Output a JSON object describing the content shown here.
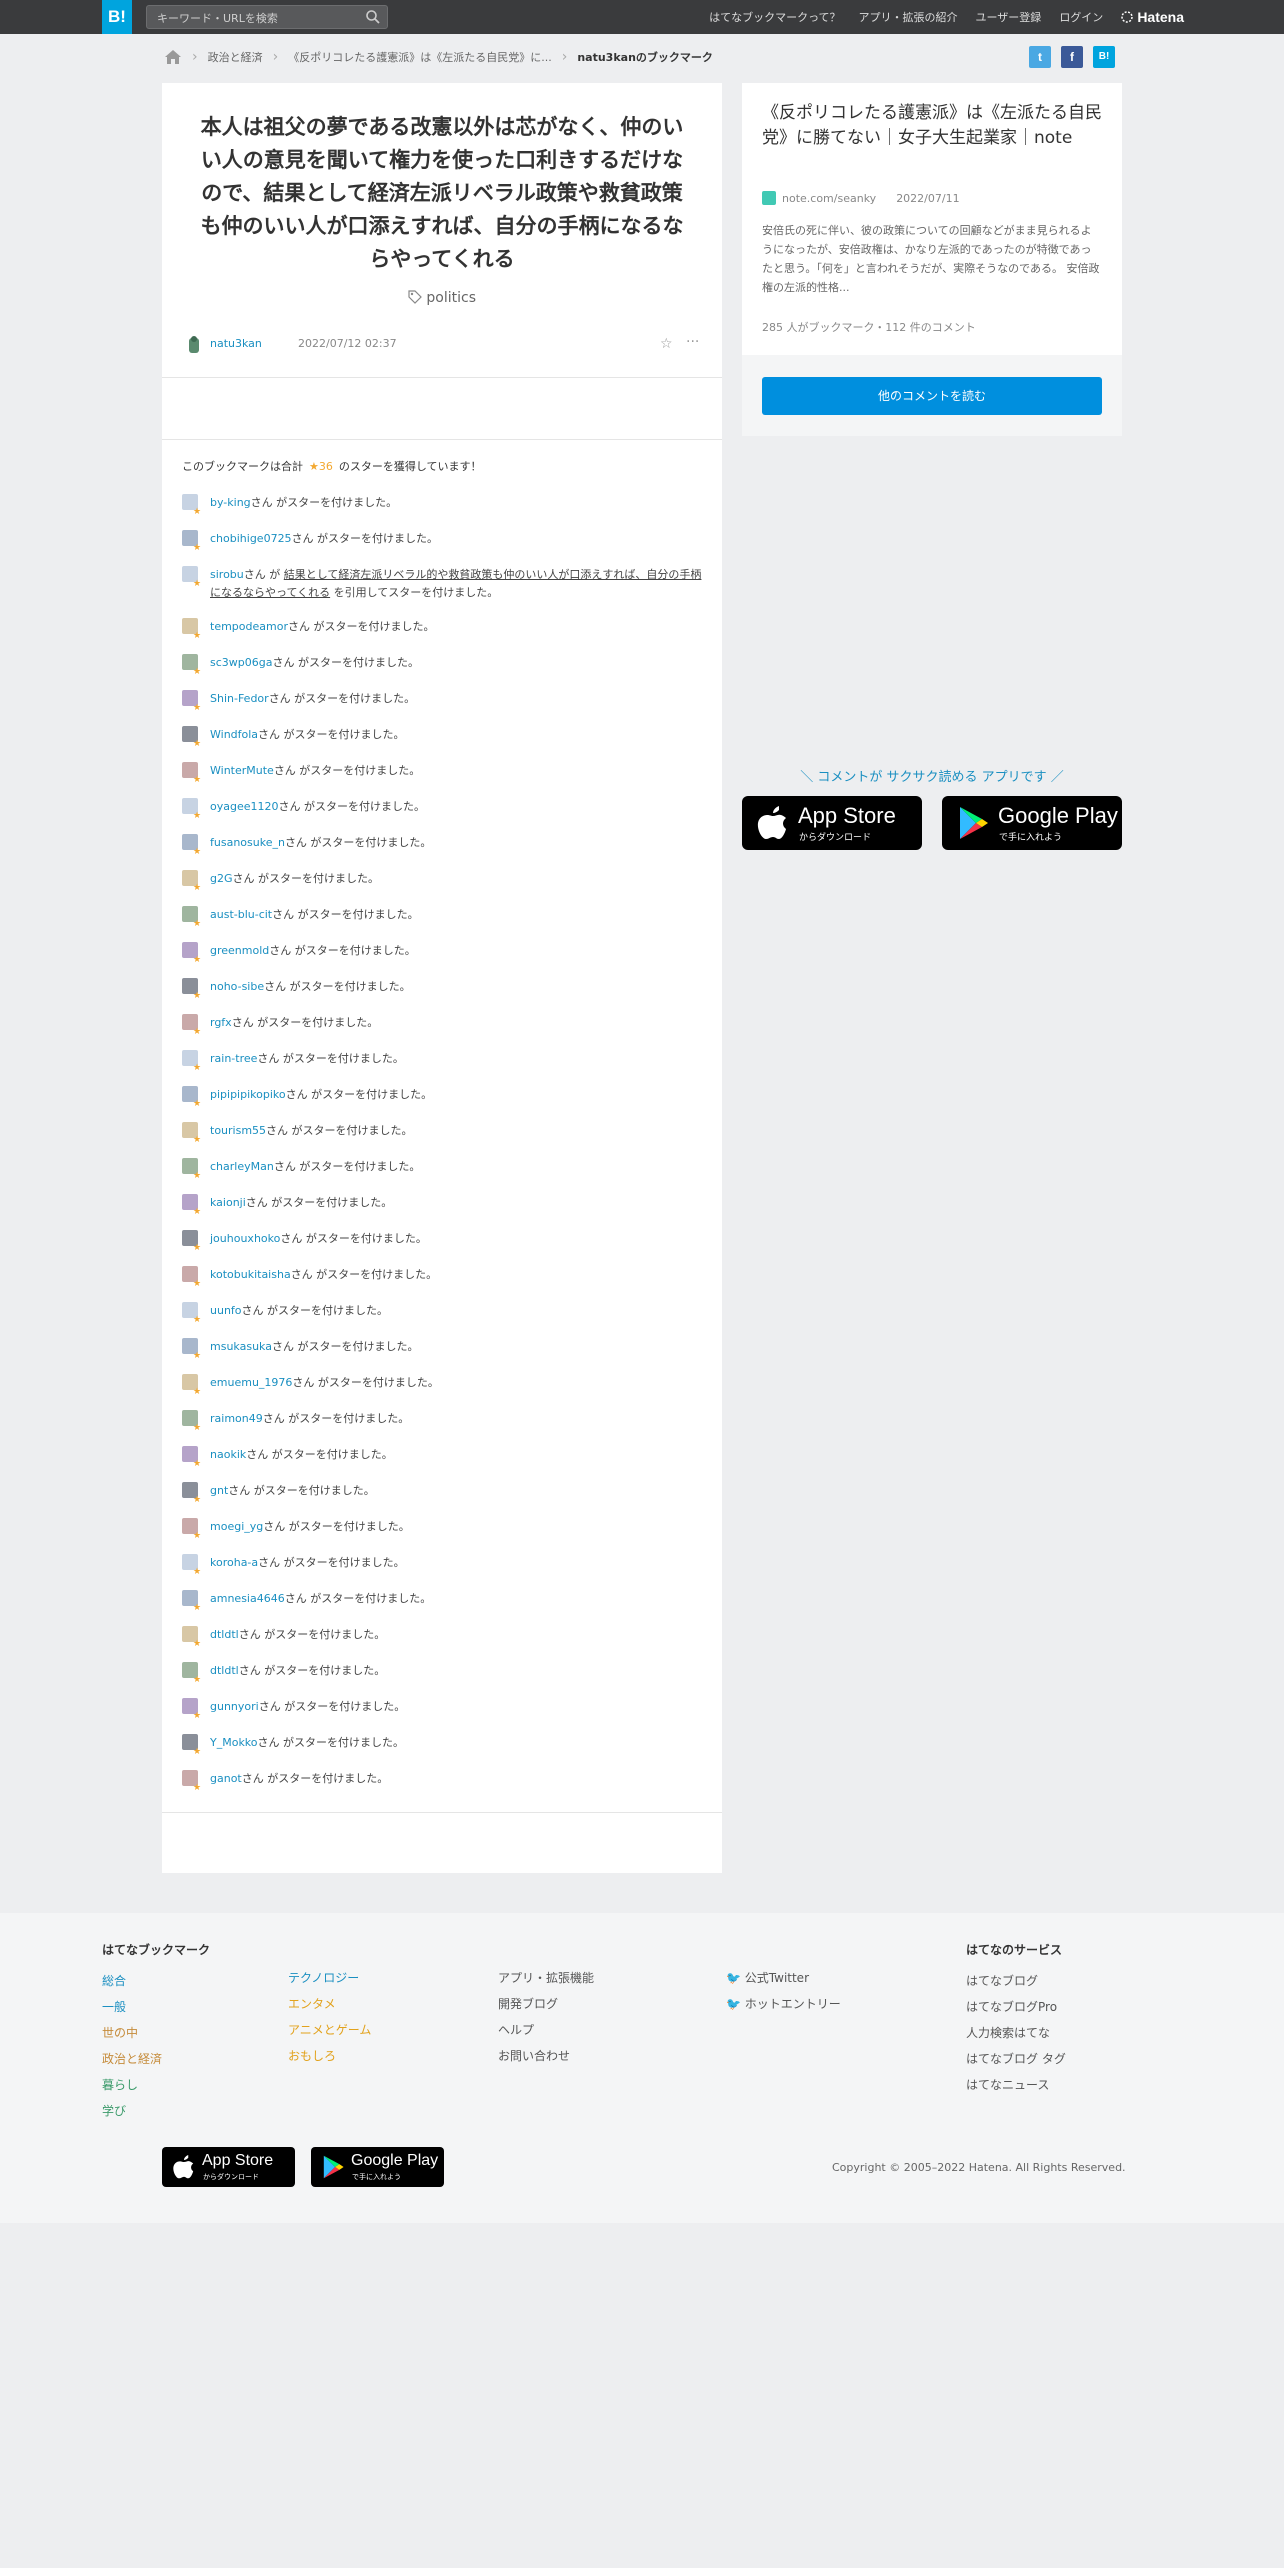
{
  "topbar": {
    "logo": "B!",
    "search_placeholder": "キーワード・URLを検索",
    "nav": [
      "はてなブックマークって？",
      "アプリ・拡張の紹介",
      "ユーザー登録",
      "ログイン"
    ],
    "brand": "Hatena"
  },
  "breadcrumb": [
    "政治と経済",
    "《反ポリコレたる護憲派》は《左派たる自民党》に...",
    "natu3kanのブックマーク"
  ],
  "bookmark": {
    "comment": "本人は祖父の夢である改憲以外は芯がなく、仲のいい人の意見を聞いて権力を使った口利きするだけなので、結果として経済左派リベラル政策や救貧政策も仲のいい人が口添えすれば、自分の手柄になるならやってくれる",
    "tag": "politics",
    "user": "natu3kan",
    "timestamp": "2022/07/12 02:37"
  },
  "stars": {
    "summary_prefix": "このブックマークは合計",
    "count": "★36",
    "summary_suffix": "のスターを獲得しています！",
    "suffix": "さん がスターを付けました。",
    "quote_user": "sirobu",
    "quote_middle": "さん が",
    "quote_text": "結果として経済左派リベラル的や救貧政策も仲のいい人が口添えすれば、自分の手柄になるならやってくれる",
    "quote_suffix": "を引用してスターを付けました。",
    "users_before": [
      "by-king",
      "chobihige0725"
    ],
    "users_after": [
      "tempodeamor",
      "sc3wp06ga",
      "Shin-Fedor",
      "Windfola",
      "WinterMute",
      "oyagee1120",
      "fusanosuke_n",
      "g2G",
      "aust-blu-cit",
      "greenmold",
      "noho-sibe",
      "rgfx",
      "rain-tree",
      "pipipipikopiko",
      "tourism55",
      "charleyMan",
      "kaionji",
      "jouhouxhoko",
      "kotobukitaisha",
      "uunfo",
      "msukasuka",
      "emuemu_1976",
      "raimon49",
      "naokik",
      "gnt",
      "moegi_yg",
      "koroha-a",
      "amnesia4646",
      "dtldtl",
      "dtldtl",
      "gunnyori",
      "Y_Mokko",
      "ganot"
    ]
  },
  "entry": {
    "title": "《反ポリコレたる護憲派》は《左派たる自民党》に勝てない｜女子大生起業家｜note",
    "source": "note.com/seanky",
    "date": "2022/07/11",
    "description": "安倍氏の死に伴い、彼の政策についての回顧などがまま見られるようになったが、安倍政権は、かなり左派的であったのが特徴であったと思う。「何を」と言われそうだが、実際そうなのである。 安倍政権の左派的性格...",
    "counts": "285 人がブックマーク・112 件のコメント",
    "button": "他のコメントを読む"
  },
  "promo": {
    "text": "＼ コメントが サクサク読める アプリです ／",
    "appstore_big": "App Store",
    "appstore_small": "からダウンロード",
    "googleplay_big": "Google Play",
    "googleplay_small": "で手に入れよう"
  },
  "footer": {
    "bookmark_head": "はてなブックマーク",
    "cats1": [
      "総合",
      "一般",
      "世の中",
      "政治と経済",
      "暮らし",
      "学び"
    ],
    "cats2": [
      "テクノロジー",
      "エンタメ",
      "アニメとゲーム",
      "おもしろ"
    ],
    "links": [
      "アプリ・拡張機能",
      "開発ブログ",
      "ヘルプ",
      "お問い合わせ"
    ],
    "social": [
      "公式Twitter",
      "ホットエントリー"
    ],
    "services_head": "はてなのサービス",
    "services": [
      "はてなブログ",
      "はてなブログPro",
      "人力検索はてな",
      "はてなブログ タグ",
      "はてなニュース"
    ],
    "copyright": "Copyright © 2005–2022 Hatena. All Rights Reserved."
  },
  "colors": {
    "brand": "#00a4de",
    "link": "#1a8fc1",
    "star": "#f3a830",
    "button": "#008fde"
  }
}
